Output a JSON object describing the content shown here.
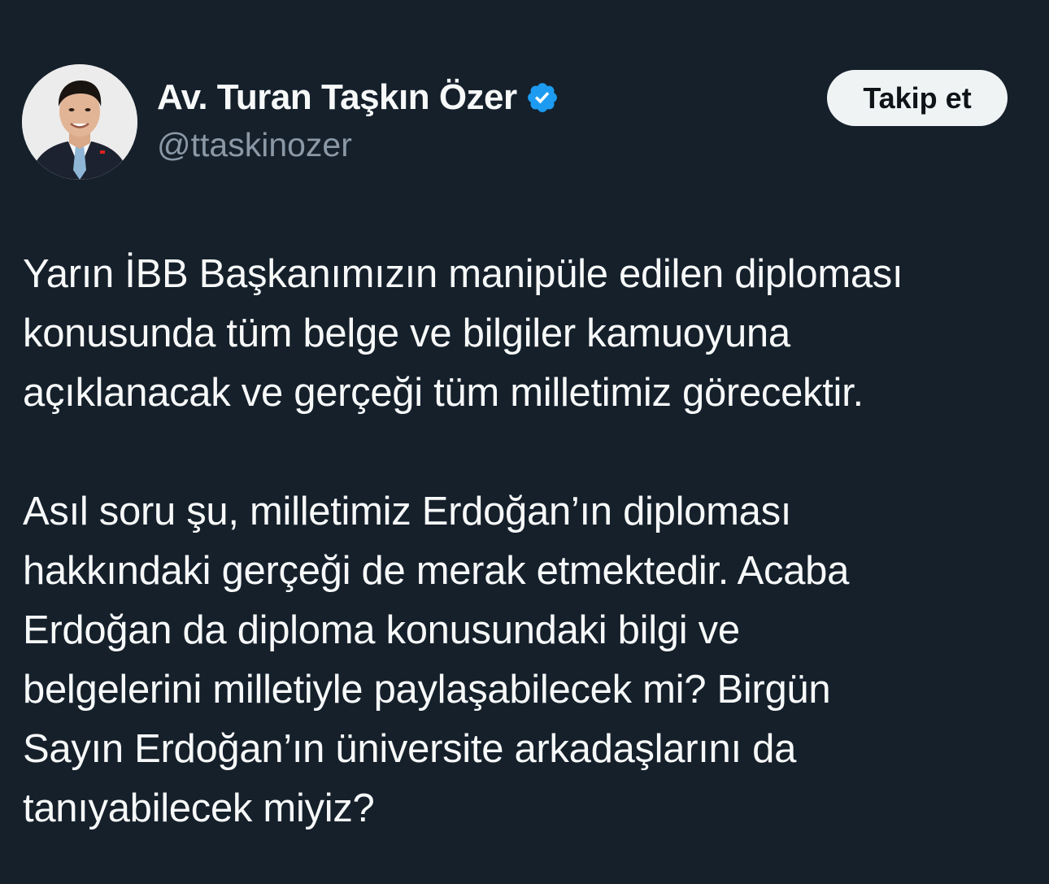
{
  "author": {
    "display_name": "Av. Turan Taşkın Özer",
    "handle": "@ttaskinozer",
    "verified": true,
    "verified_color": "#1d9bf0"
  },
  "actions": {
    "follow_label": "Takip et"
  },
  "tweet": {
    "paragraphs": [
      {
        "lines": [
          "Yarın İBB Başkanımızın manipüle edilen diploması",
          "konusunda tüm belge ve bilgiler kamuoyuna",
          "açıklanacak ve gerçeği tüm milletimiz görecektir."
        ]
      },
      {
        "lines": [
          "Asıl soru şu, milletimiz Erdoğan’ın diploması",
          "hakkındaki gerçeği de merak etmektedir. Acaba",
          "Erdoğan da diploma konusundaki bilgi ve",
          "belgelerini milletiyle paylaşabilecek mi? Birgün",
          "Sayın Erdoğan’ın üniversite arkadaşlarını da",
          "tanıyabilecek miyiz?"
        ]
      }
    ]
  },
  "colors": {
    "background": "#15202b",
    "text_primary": "#f7f9f9",
    "text_secondary": "#8b98a5",
    "button_bg": "#eff3f4",
    "button_text": "#0f1419"
  }
}
